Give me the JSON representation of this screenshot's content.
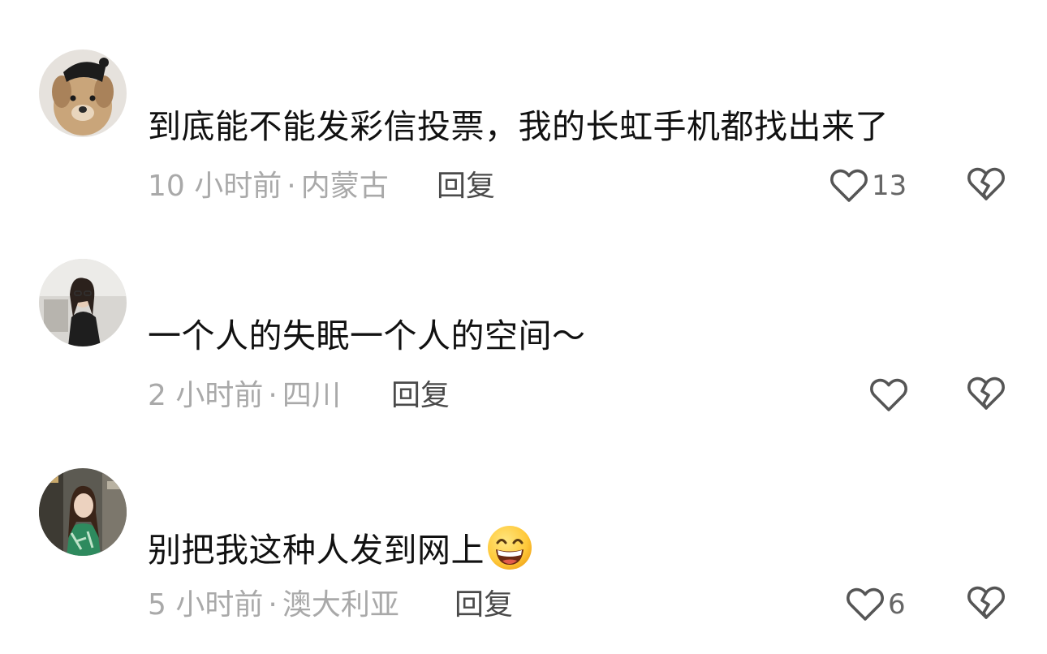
{
  "comments": [
    {
      "avatar": "dog-avatar",
      "text": "到底能不能发彩信投票，我的长虹手机都找出来了",
      "emoji": "",
      "time": "10 小时前",
      "separator": "·",
      "location": "内蒙古",
      "reply_label": "回复",
      "like_count": "13"
    },
    {
      "avatar": "woman-dark-avatar",
      "text": "一个人的失眠一个人的空间～",
      "emoji": "",
      "time": "2 小时前",
      "separator": "·",
      "location": "四川",
      "reply_label": "回复",
      "like_count": ""
    },
    {
      "avatar": "woman-green-avatar",
      "text": "别把我这种人发到网上",
      "emoji": "grinning-face-emoji",
      "time": "5 小时前",
      "separator": "·",
      "location": "澳大利亚",
      "reply_label": "回复",
      "like_count": "6"
    }
  ],
  "colors": {
    "text": "#111111",
    "meta": "#a9a9a9",
    "reply": "#4a4a4a",
    "icon": "#555555"
  },
  "icons": {
    "like": "heart-outline-icon",
    "dislike": "broken-heart-outline-icon"
  }
}
